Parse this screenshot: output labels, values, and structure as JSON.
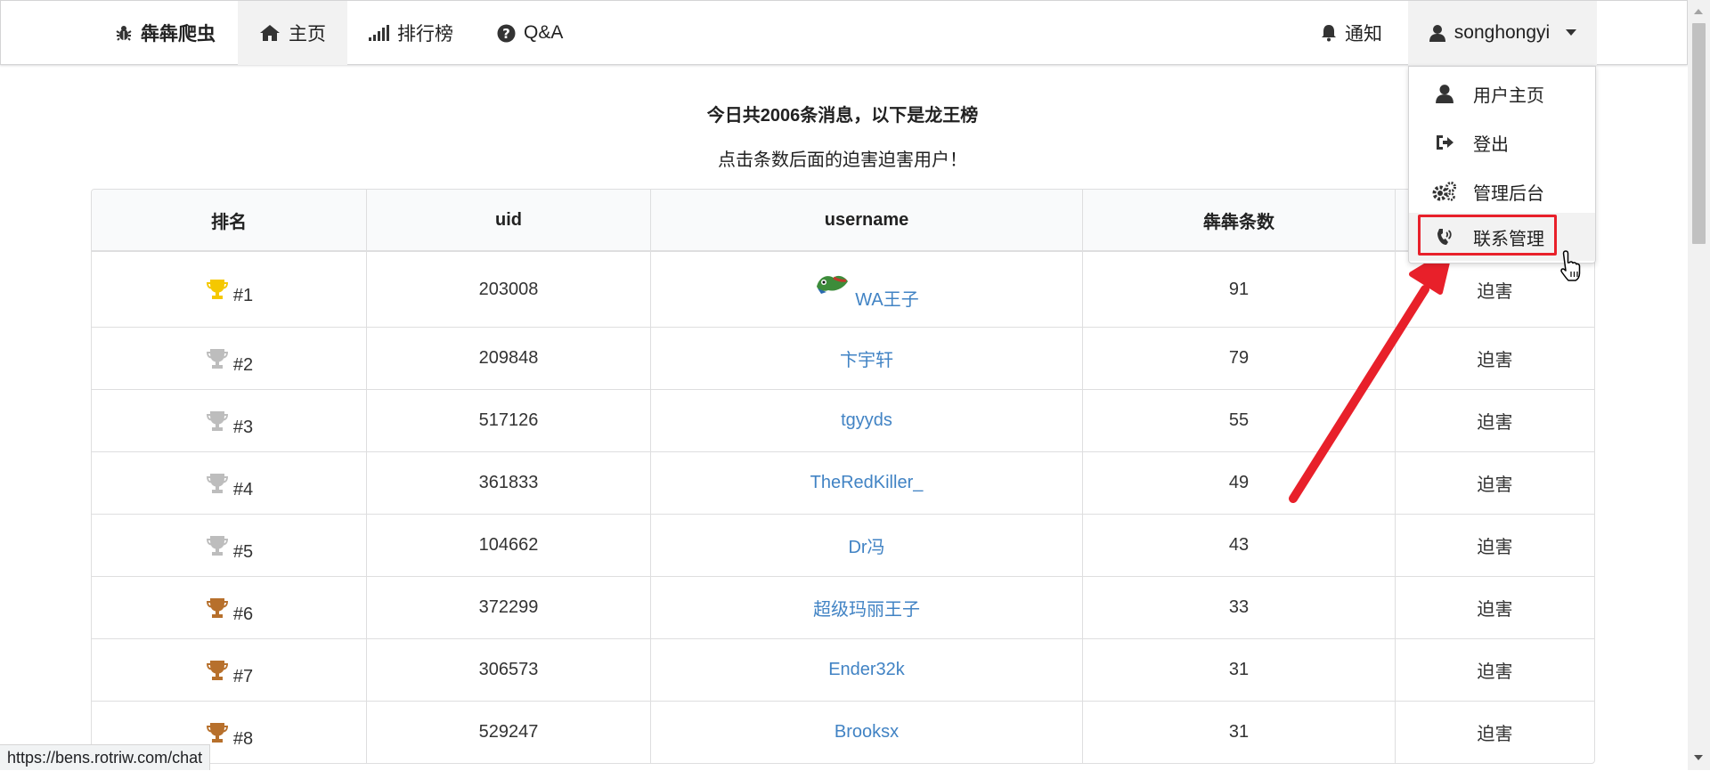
{
  "navbar": {
    "brand": "犇犇爬虫",
    "items": [
      {
        "label": "主页",
        "icon": "home-icon",
        "active": true
      },
      {
        "label": "排行榜",
        "icon": "signal-bars-icon"
      },
      {
        "label": "Q&A",
        "icon": "question-circle-icon"
      }
    ],
    "notify_label": "通知",
    "user_label": "songhongyi"
  },
  "dropdown": {
    "items": [
      {
        "label": "用户主页",
        "icon": "user-icon"
      },
      {
        "label": "登出",
        "icon": "sign-out-icon"
      },
      {
        "label": "管理后台",
        "icon": "cogs-icon"
      },
      {
        "label": "联系管理",
        "icon": "volume-control-phone-icon"
      }
    ]
  },
  "headline": "今日共2006条消息，以下是龙王榜",
  "subline": "点击条数后面的迫害迫害用户！",
  "table": {
    "headers": [
      "排名",
      "uid",
      "username",
      "犇犇条数",
      ""
    ],
    "rows": [
      {
        "rank": "#1",
        "trophy": "gold",
        "uid": "203008",
        "username": "WA王子",
        "count": "91",
        "action": "迫害",
        "has_avatar": true
      },
      {
        "rank": "#2",
        "trophy": "silver",
        "uid": "209848",
        "username": "卞宇轩",
        "count": "79",
        "action": "迫害"
      },
      {
        "rank": "#3",
        "trophy": "silver",
        "uid": "517126",
        "username": "tgyyds",
        "count": "55",
        "action": "迫害"
      },
      {
        "rank": "#4",
        "trophy": "silver",
        "uid": "361833",
        "username": "TheRedKiller_",
        "count": "49",
        "action": "迫害"
      },
      {
        "rank": "#5",
        "trophy": "silver",
        "uid": "104662",
        "username": "Dr冯",
        "count": "43",
        "action": "迫害"
      },
      {
        "rank": "#6",
        "trophy": "bronze",
        "uid": "372299",
        "username": "超级玛丽王子",
        "count": "33",
        "action": "迫害"
      },
      {
        "rank": "#7",
        "trophy": "bronze",
        "uid": "306573",
        "username": "Ender32k",
        "count": "31",
        "action": "迫害"
      },
      {
        "rank": "#8",
        "trophy": "bronze",
        "uid": "529247",
        "username": "Brooksx",
        "count": "31",
        "action": "迫害"
      }
    ]
  },
  "status_url": "https://bens.rotriw.com/chat",
  "colors": {
    "link": "#4183c4",
    "gold": "#f5c800",
    "silver": "#bdbdbd",
    "bronze": "#b7702c",
    "annotation_red": "#e8202a"
  }
}
